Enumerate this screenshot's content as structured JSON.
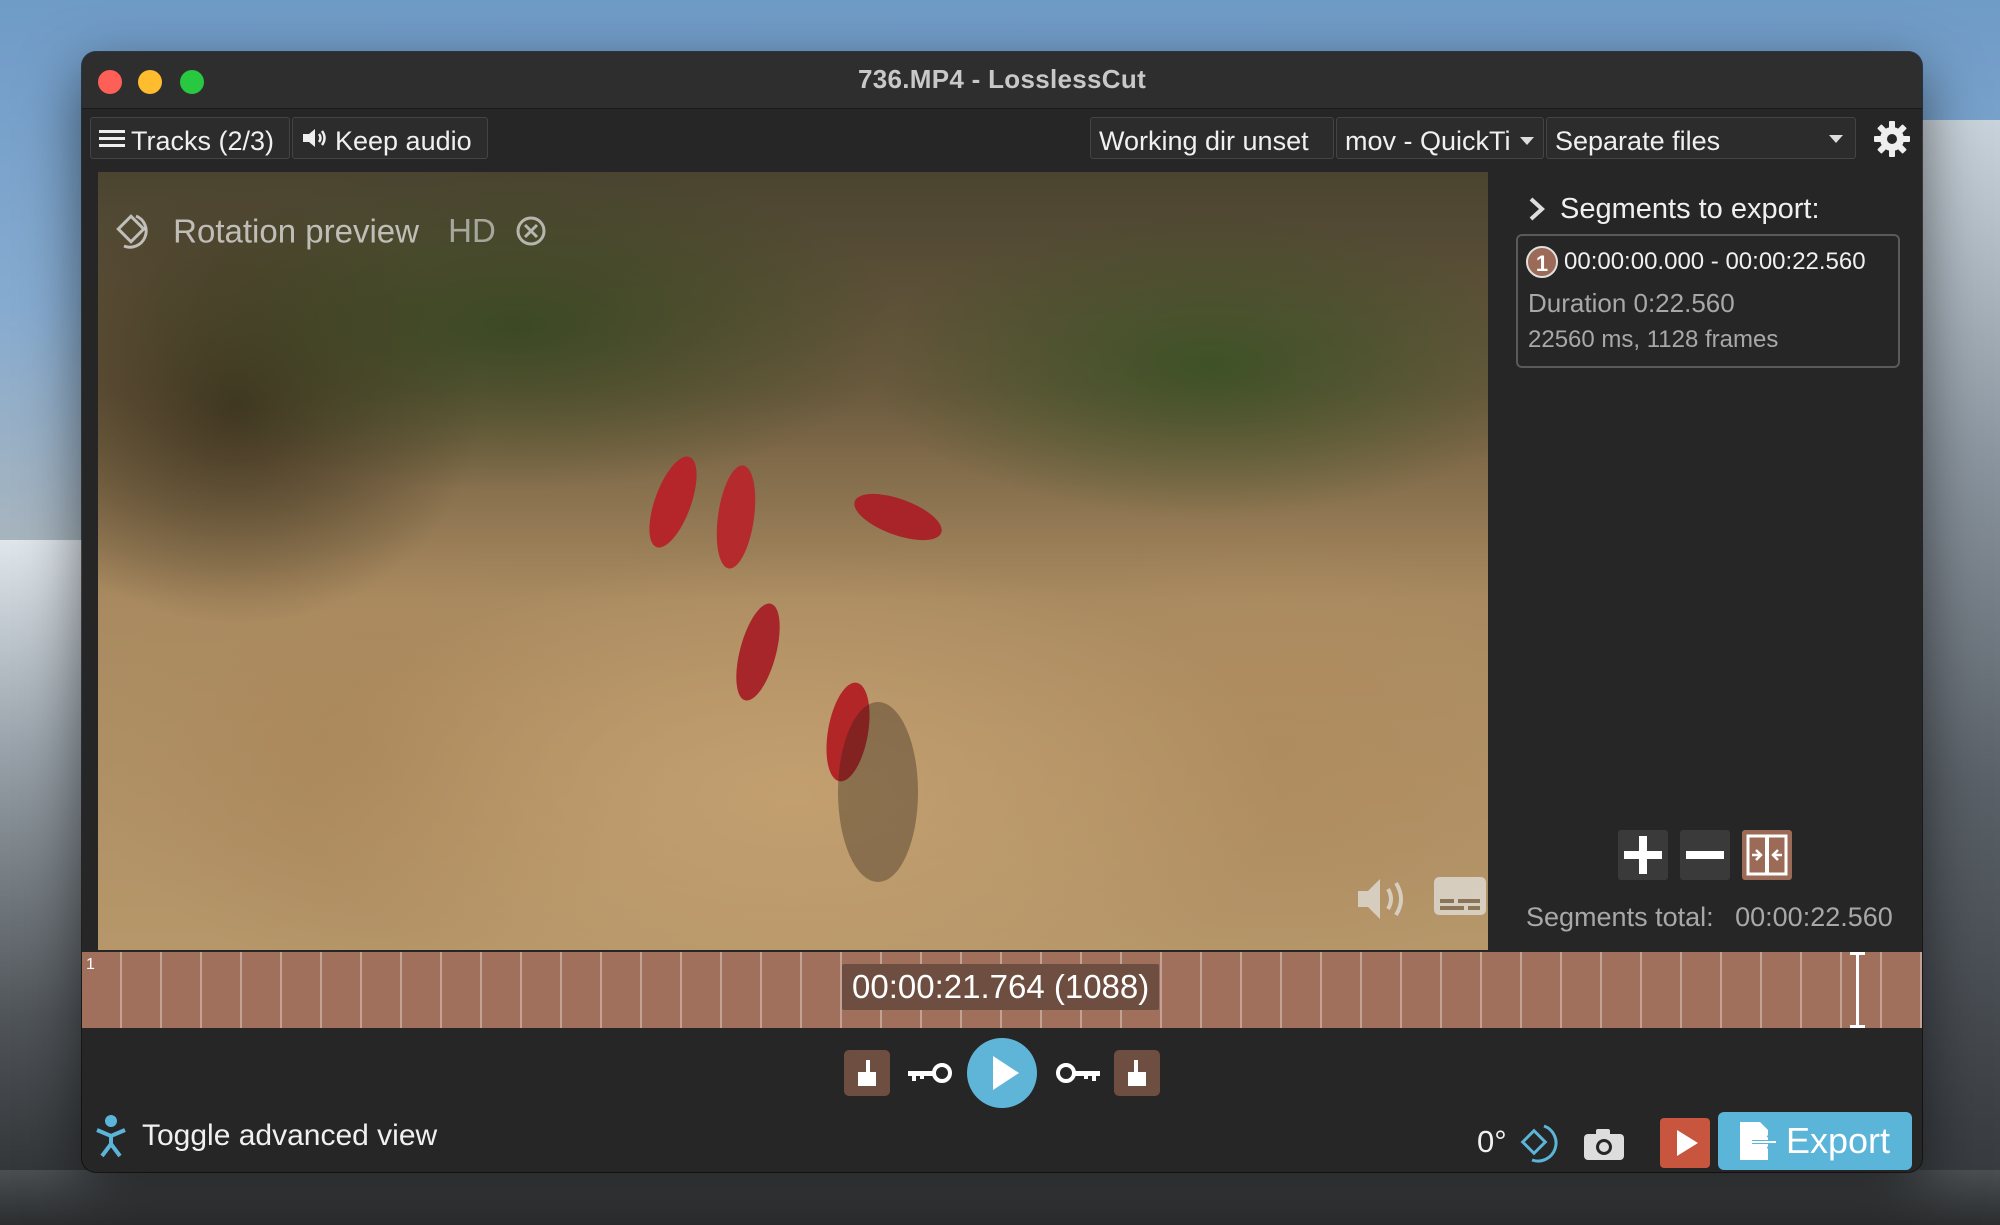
{
  "window": {
    "title": "736.MP4 - LosslessCut"
  },
  "toolbar": {
    "tracks_label": "Tracks (2/3)",
    "audio_label": "Keep audio",
    "working_dir_label": "Working dir unset",
    "format_label": "mov - QuickTi",
    "output_mode_label": "Separate files"
  },
  "video": {
    "rotation_preview_label": "Rotation preview",
    "hd_label": "HD"
  },
  "sidebar": {
    "header": "Segments to export:",
    "segments": [
      {
        "number": "1",
        "range": "00:00:00.000 - 00:00:22.560",
        "duration": "Duration 0:22.560",
        "details": "22560 ms, 1128 frames"
      }
    ],
    "total_label": "Segments total:",
    "total_value": "00:00:22.560"
  },
  "timeline": {
    "segment_marker": "1",
    "current_time": "00:00:21.764 (1088)"
  },
  "controls": {
    "advanced_view_label": "Toggle advanced view",
    "rotation_value": "0°",
    "export_label": "Export"
  },
  "colors": {
    "accent": "#5bb5d8",
    "segment": "#a0705c",
    "render_button": "#c8553d"
  }
}
